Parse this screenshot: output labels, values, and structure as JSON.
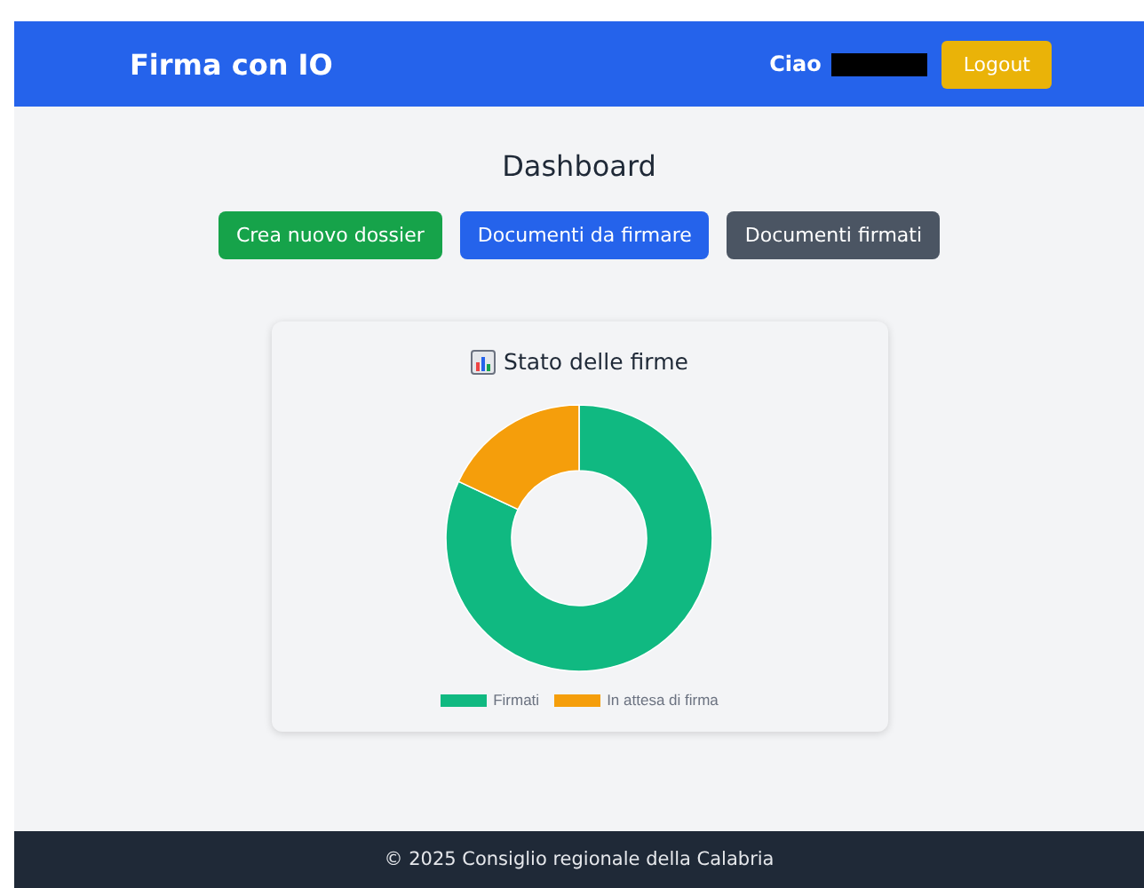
{
  "header": {
    "brand": "Firma con IO",
    "greeting": "Ciao",
    "name_redacted": true,
    "logout": "Logout"
  },
  "title": "Dashboard",
  "actions": [
    {
      "label": "Crea nuovo dossier",
      "color": "#16a34a"
    },
    {
      "label": "Documenti da firmare",
      "color": "#2563eb"
    },
    {
      "label": "Documenti firmati",
      "color": "#4b5563"
    }
  ],
  "card": {
    "title": "Stato delle firme",
    "legend": [
      {
        "label": "Firmati",
        "color": "#10b981"
      },
      {
        "label": "In attesa di firma",
        "color": "#f59e0b"
      }
    ]
  },
  "footer": "© 2025 Consiglio regionale della Calabria"
}
